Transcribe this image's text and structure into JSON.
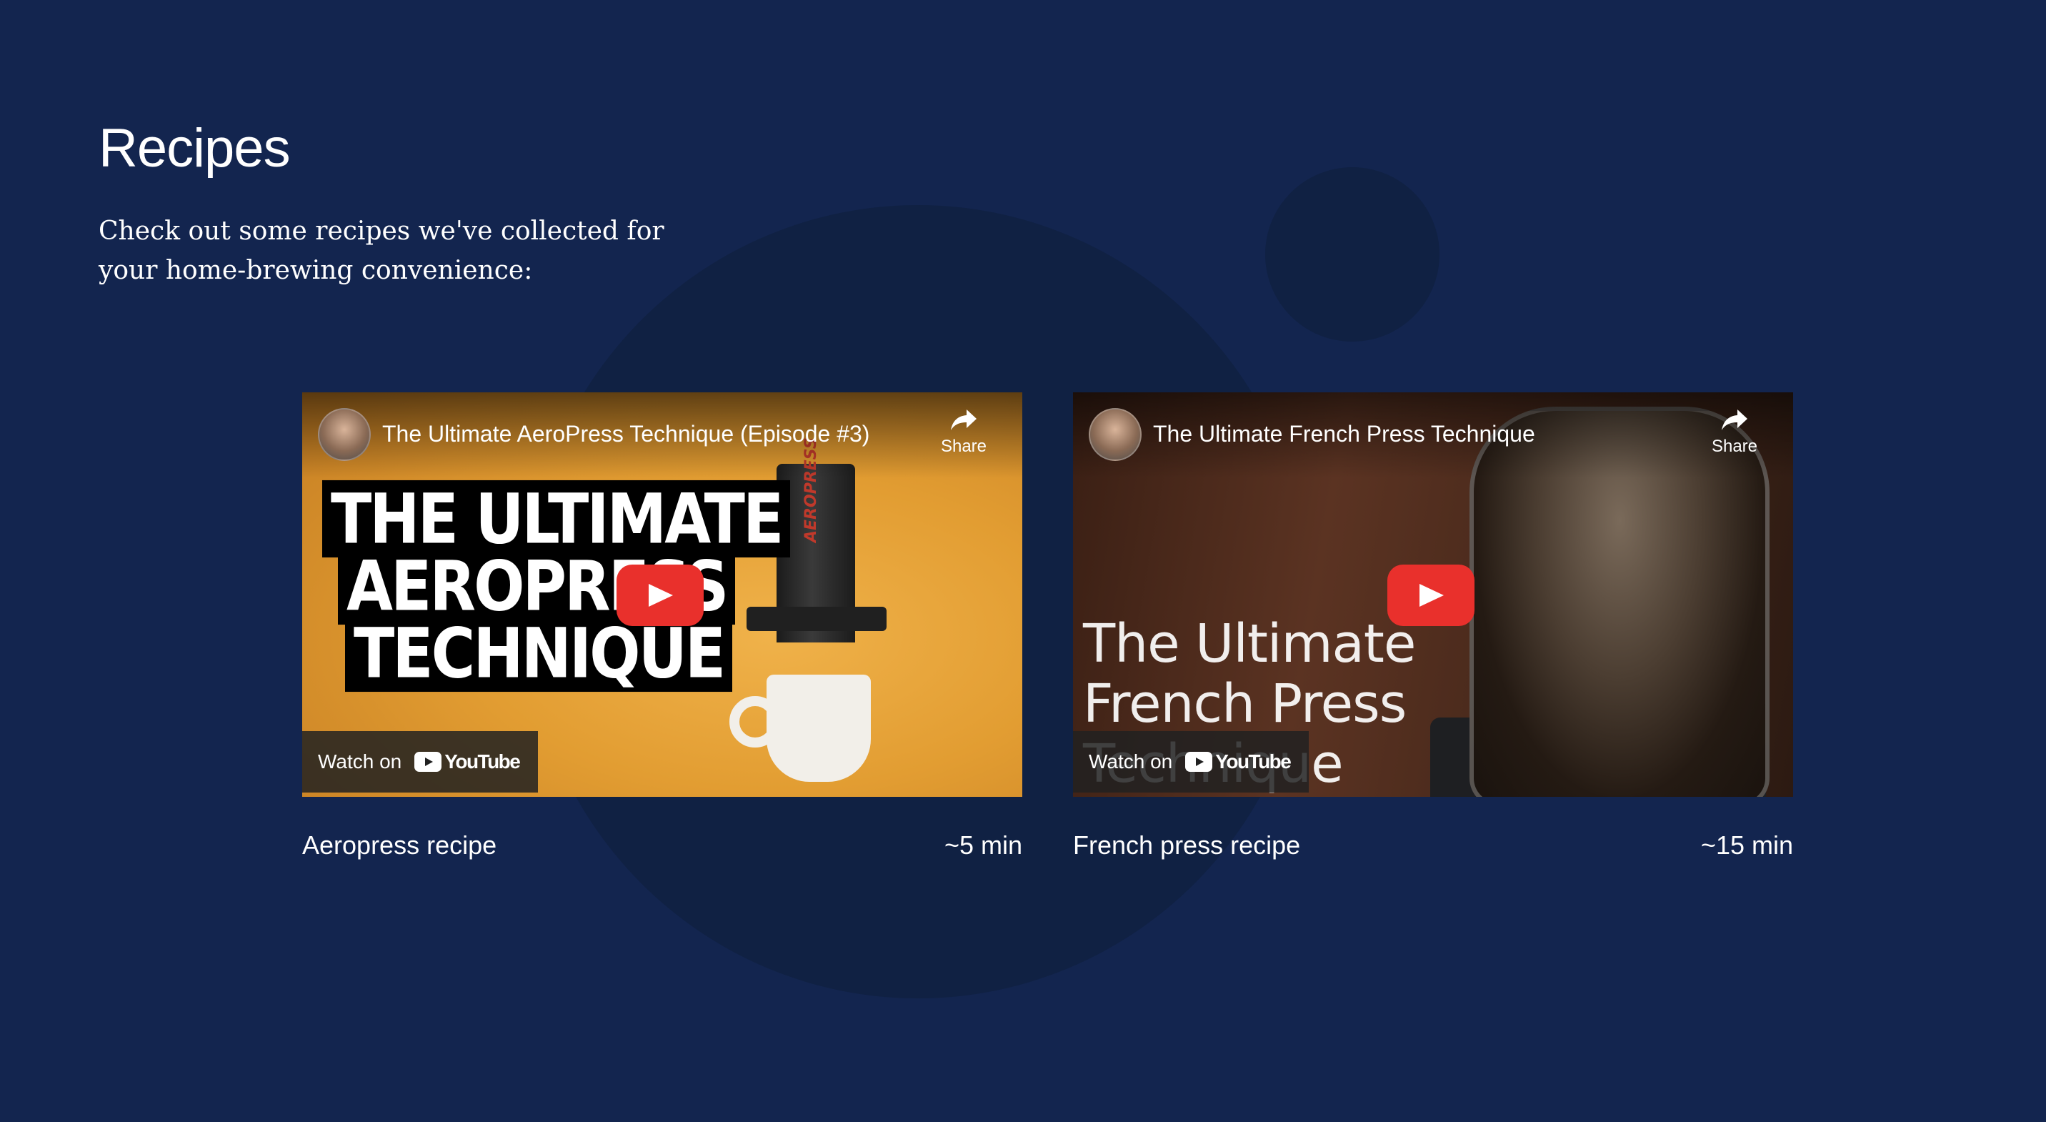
{
  "page": {
    "title": "Recipes",
    "intro_line1": "Check out some recipes we've collected for",
    "intro_line2": "your home-brewing convenience:"
  },
  "videos": [
    {
      "video_title": "The Ultimate AeroPress Technique (Episode #3)",
      "share_label": "Share",
      "watch_on_label": "Watch on",
      "youtube_label": "YouTube",
      "thumbnail_headline": [
        "THE ULTIMATE",
        "AEROPRESS",
        "TECHNIQUE"
      ],
      "thumbnail_brand": "AEROPRESS",
      "caption": "Aeropress recipe",
      "duration": "~5 min"
    },
    {
      "video_title": "The Ultimate French Press Technique",
      "share_label": "Share",
      "watch_on_label": "Watch on",
      "youtube_label": "YouTube",
      "thumbnail_headline": [
        "The Ultimate",
        "French Press",
        "Technique"
      ],
      "caption": "French press recipe",
      "duration": "~15 min"
    }
  ],
  "icons": {
    "share": "share-arrow-icon",
    "play": "play-icon",
    "youtube": "youtube-logo-icon",
    "avatar": "channel-avatar"
  },
  "colors": {
    "background": "#13254f",
    "background_circle": "#102143",
    "play_button": "#e9302c",
    "text": "#ffffff"
  }
}
